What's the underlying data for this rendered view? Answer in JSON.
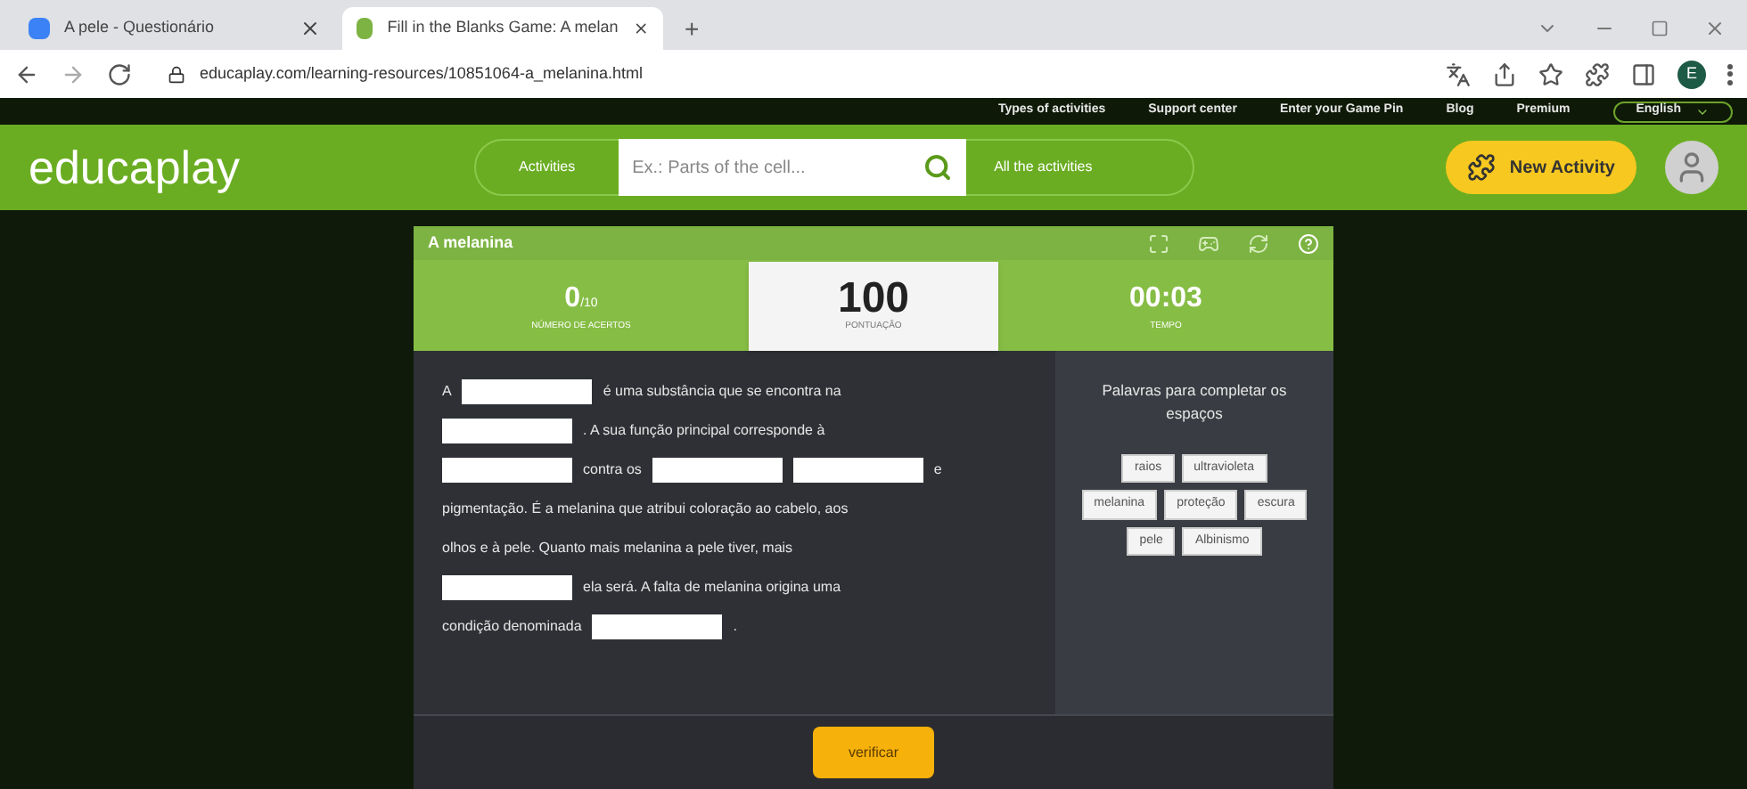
{
  "browser": {
    "tabs": [
      {
        "title": "A pele - Questionário",
        "selected": false
      },
      {
        "title": "Fill in the Blanks Game: A melan",
        "selected": true
      }
    ],
    "new_tab": "+",
    "url": "educaplay.com/learning-resources/10851064-a_melanina.html",
    "profile": "E"
  },
  "top_links": [
    "Types of activities",
    "Support center",
    "Enter your Game Pin",
    "Blog",
    "Premium"
  ],
  "language": "English",
  "header": {
    "logo": "educaplay",
    "activities": "Activities",
    "search_placeholder": "Ex.: Parts of the cell...",
    "all_activities": "All the activities",
    "new_activity": "New Activity"
  },
  "game": {
    "title": "A melanina",
    "hits": "0",
    "hits_total": "/10",
    "hits_label": "NÚMERO DE ACERTOS",
    "score": "100",
    "score_label": "PONTUAÇÃO",
    "time": "00:03",
    "time_label": "TEMPO",
    "lines": [
      [
        {
          "kind": "text",
          "text": "A"
        },
        {
          "kind": "blank"
        },
        {
          "kind": "text",
          "text": "é uma substância que se encontra na"
        }
      ],
      [
        {
          "kind": "blank"
        },
        {
          "kind": "text",
          "text": ". A sua função principal corresponde à"
        }
      ],
      [
        {
          "kind": "blank"
        },
        {
          "kind": "text",
          "text": "contra os"
        },
        {
          "kind": "blank"
        },
        {
          "kind": "blank"
        },
        {
          "kind": "text",
          "text": "e"
        }
      ],
      [
        {
          "kind": "text",
          "text": "pigmentação. É a melanina que atribui coloração ao cabelo, aos"
        }
      ],
      [
        {
          "kind": "text",
          "text": "olhos e à pele. Quanto mais melanina a pele tiver, mais"
        }
      ],
      [
        {
          "kind": "blank"
        },
        {
          "kind": "text",
          "text": "ela será. A falta de melanina origina uma"
        }
      ],
      [
        {
          "kind": "text",
          "text": "condição denominada"
        },
        {
          "kind": "blank"
        },
        {
          "kind": "text",
          "text": "."
        }
      ]
    ],
    "words_title": "Palavras para completar os espaços",
    "word_rows": [
      [
        "raios",
        "ultravioleta"
      ],
      [
        "melanina",
        "proteção",
        "escura"
      ],
      [
        "pele",
        "Albinismo"
      ]
    ],
    "check": "verificar"
  }
}
